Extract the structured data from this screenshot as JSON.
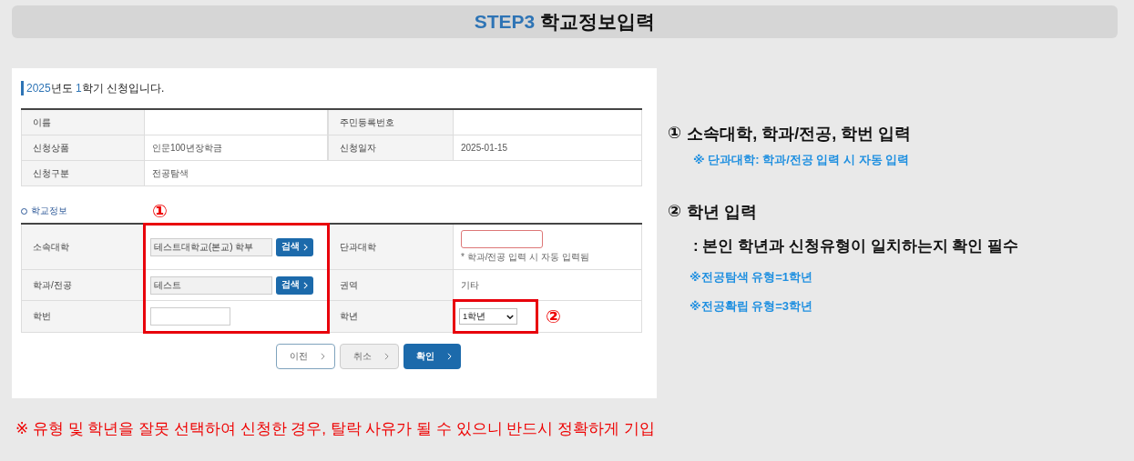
{
  "header": {
    "step": "STEP3",
    "title": "학교정보입력"
  },
  "form": {
    "heading": [
      {
        "text": "2025",
        "accent": true
      },
      {
        "text": "년도 ",
        "accent": false
      },
      {
        "text": "1",
        "accent": true
      },
      {
        "text": "학기 신청입니다.",
        "accent": false
      }
    ],
    "info_rows": [
      {
        "label": "이름",
        "label_2": "주민등록번호"
      },
      {
        "label": "신청상품",
        "value": "인문100년장학금",
        "label_2": "신청일자",
        "value_2": "2025-01-15"
      },
      {
        "label": "신청구분",
        "value": "전공탐색"
      }
    ],
    "school": {
      "title": "학교정보",
      "marker_1": "①",
      "marker_2": "②",
      "affiliation": {
        "label": "소속대학",
        "value": "테스트대학교(본교) 학부",
        "button": "검색"
      },
      "major": {
        "label": "학과/전공",
        "value": "테스트",
        "button": "검색"
      },
      "student_id": {
        "label": "학번"
      },
      "college": {
        "label": "단과대학",
        "hint": "* 학과/전공 입력 시 자동 입력됨",
        "invalid": true
      },
      "region": {
        "label": "권역",
        "value": "기타"
      },
      "grade": {
        "label": "학년",
        "value": "1학년"
      }
    },
    "buttons": [
      {
        "label": "이전",
        "kind": "outline"
      },
      {
        "label": "취소",
        "kind": "gray"
      },
      {
        "label": "확인",
        "kind": "primary"
      }
    ]
  },
  "guide": [
    {
      "number": "①",
      "title": "소속대학, 학과/전공, 학번 입력",
      "notes": [
        {
          "text": "※ 단과대학: 학과/전공 입력 시 자동 입력",
          "kind": "note"
        }
      ]
    },
    {
      "number": "②",
      "title": "학년 입력",
      "notes": [
        {
          "text": ": 본인 학년과 신청유형이 일치하는지 확인 필수",
          "kind": "detail"
        },
        {
          "text": "※전공탐색 유형=1학년",
          "kind": "note"
        },
        {
          "text": "※전공확립 유형=3학년",
          "kind": "note"
        }
      ]
    }
  ],
  "warning": "※ 유형 및 학년을 잘못 선택하여 신청한 경우, 탈락 사유가 될 수 있으니 반드시 정확하게 기입"
}
